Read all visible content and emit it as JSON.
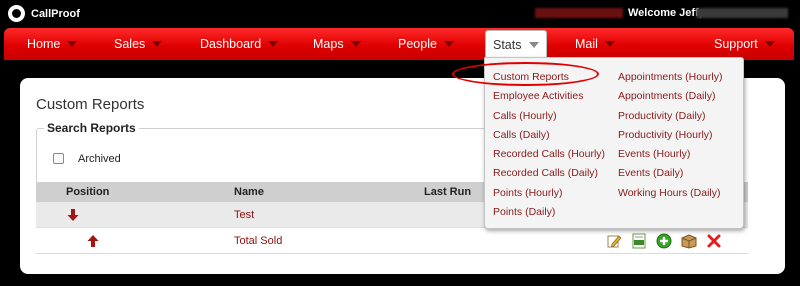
{
  "header": {
    "app_name": "CallProof",
    "welcome": "Welcome Jeff,"
  },
  "nav": {
    "items": [
      {
        "label": "Home"
      },
      {
        "label": "Sales"
      },
      {
        "label": "Dashboard"
      },
      {
        "label": "Maps"
      },
      {
        "label": "People"
      },
      {
        "label": "Stats"
      },
      {
        "label": "Mail"
      },
      {
        "label": "Support"
      }
    ],
    "active": "Stats"
  },
  "page": {
    "title": "Custom Reports",
    "search": {
      "legend": "Search Reports",
      "archived_label": "Archived",
      "archived_checked": false
    }
  },
  "table": {
    "headers": [
      "Position",
      "Name",
      "Last Run"
    ],
    "rows": [
      {
        "position_icon": "arrow-down-icon",
        "name": "Test"
      },
      {
        "position_icon": "arrow-up-icon",
        "name": "Total Sold",
        "actions": [
          "edit-icon",
          "export-csv-icon",
          "add-icon",
          "archive-box-icon",
          "delete-icon"
        ]
      }
    ]
  },
  "stats_menu": {
    "left": [
      "Custom Reports",
      "Employee Activities",
      "Calls (Hourly)",
      "Calls (Daily)",
      "Recorded Calls (Hourly)",
      "Recorded Calls (Daily)",
      "Points (Hourly)",
      "Points (Daily)"
    ],
    "right": [
      "Appointments (Hourly)",
      "Appointments (Daily)",
      "Productivity (Daily)",
      "Productivity (Hourly)",
      "Events (Hourly)",
      "Events (Daily)",
      "Working Hours (Daily)"
    ],
    "highlighted": "Custom Reports"
  },
  "colors": {
    "nav_red": "#e00000",
    "link_red": "#8b1a1a",
    "highlight_oval": "#e00000"
  }
}
